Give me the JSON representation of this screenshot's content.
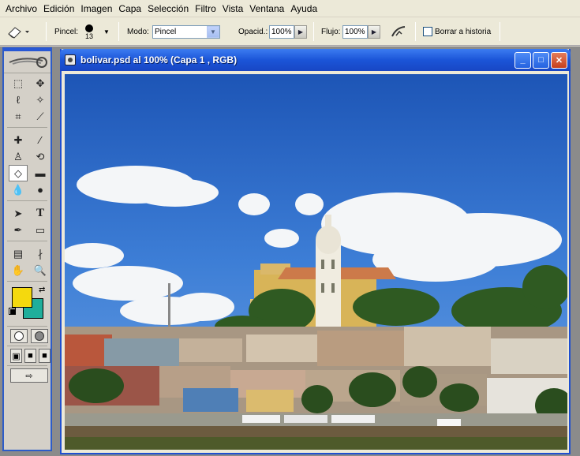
{
  "menubar": {
    "items": [
      "Archivo",
      "Edición",
      "Imagen",
      "Capa",
      "Selección",
      "Filtro",
      "Vista",
      "Ventana",
      "Ayuda"
    ]
  },
  "options": {
    "pincel_label": "Pincel:",
    "brush_size": "13",
    "modo_label": "Modo:",
    "modo_value": "Pincel",
    "opacidad_label": "Opacid.:",
    "opacidad_value": "100%",
    "flujo_label": "Flujo:",
    "flujo_value": "100%",
    "borrar_historia_label": "Borrar a historia"
  },
  "document": {
    "title": "bolivar.psd al 100% (Capa 1 , RGB)",
    "minimize": "_",
    "maximize": "□",
    "close": "✕"
  },
  "toolbox": {
    "foreground_color": "#f4d90e",
    "background_color": "#1fae9b"
  },
  "icons": [
    "eraser-icon",
    "brush-icon",
    "airbrush-icon",
    "marquee-icon",
    "move-icon",
    "lasso-icon",
    "magic-wand-icon",
    "crop-icon",
    "slice-icon",
    "healing-icon",
    "brush-tool-icon",
    "stamp-icon",
    "history-brush-icon",
    "eraser-tool-icon",
    "gradient-icon",
    "blur-icon",
    "dodge-icon",
    "path-select-icon",
    "type-icon",
    "pen-icon",
    "shape-icon",
    "notes-icon",
    "eyedropper-icon",
    "hand-icon",
    "zoom-icon"
  ]
}
